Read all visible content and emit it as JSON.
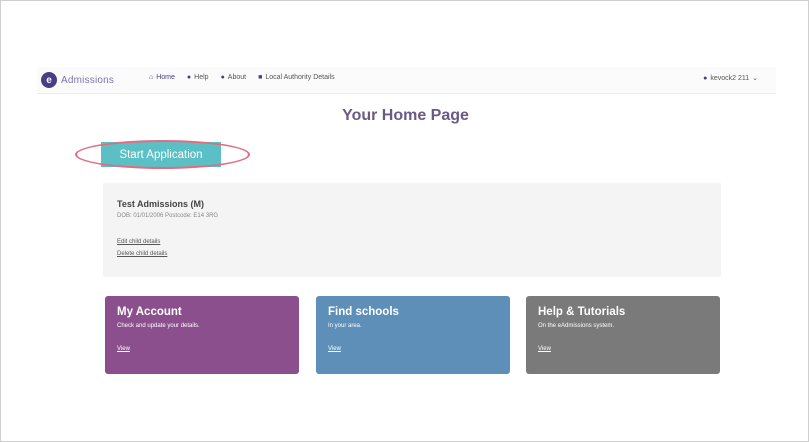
{
  "nav": {
    "logo_letter": "e",
    "logo_text": "Admissions",
    "links": [
      {
        "icon": "home-icon",
        "glyph": "⌂",
        "label": "Home"
      },
      {
        "icon": "help-icon",
        "glyph": "●",
        "label": "Help"
      },
      {
        "icon": "info-icon",
        "glyph": "●",
        "label": "About"
      },
      {
        "icon": "building-icon",
        "glyph": "■",
        "label": "Local Authority Details"
      }
    ],
    "user": {
      "icon": "user-icon",
      "label": "kevock2 211",
      "caret": "⌄"
    }
  },
  "page": {
    "title": "Your Home Page"
  },
  "start_button": {
    "label": "Start Application"
  },
  "child": {
    "name": "Test Admissions (M)",
    "meta": "DOB: 01/01/2006 Postcode: E14 3RG",
    "edit_link": "Edit child details",
    "delete_link": "Delete child details"
  },
  "tiles": {
    "account": {
      "title": "My Account",
      "subtitle": "Check and update your details.",
      "link": "View"
    },
    "schools": {
      "title": "Find schools",
      "subtitle": "In your area.",
      "link": "View"
    },
    "help": {
      "title": "Help & Tutorials",
      "subtitle": "On the eAdmissions system.",
      "link": "View"
    }
  },
  "colors": {
    "brand": "#4a3d86",
    "start_button": "#5bc0c6",
    "highlight": "#e36b7f",
    "account_tile": "#8b4f8e",
    "schools_tile": "#5e8fb9",
    "help_tile": "#7a7a7a"
  }
}
